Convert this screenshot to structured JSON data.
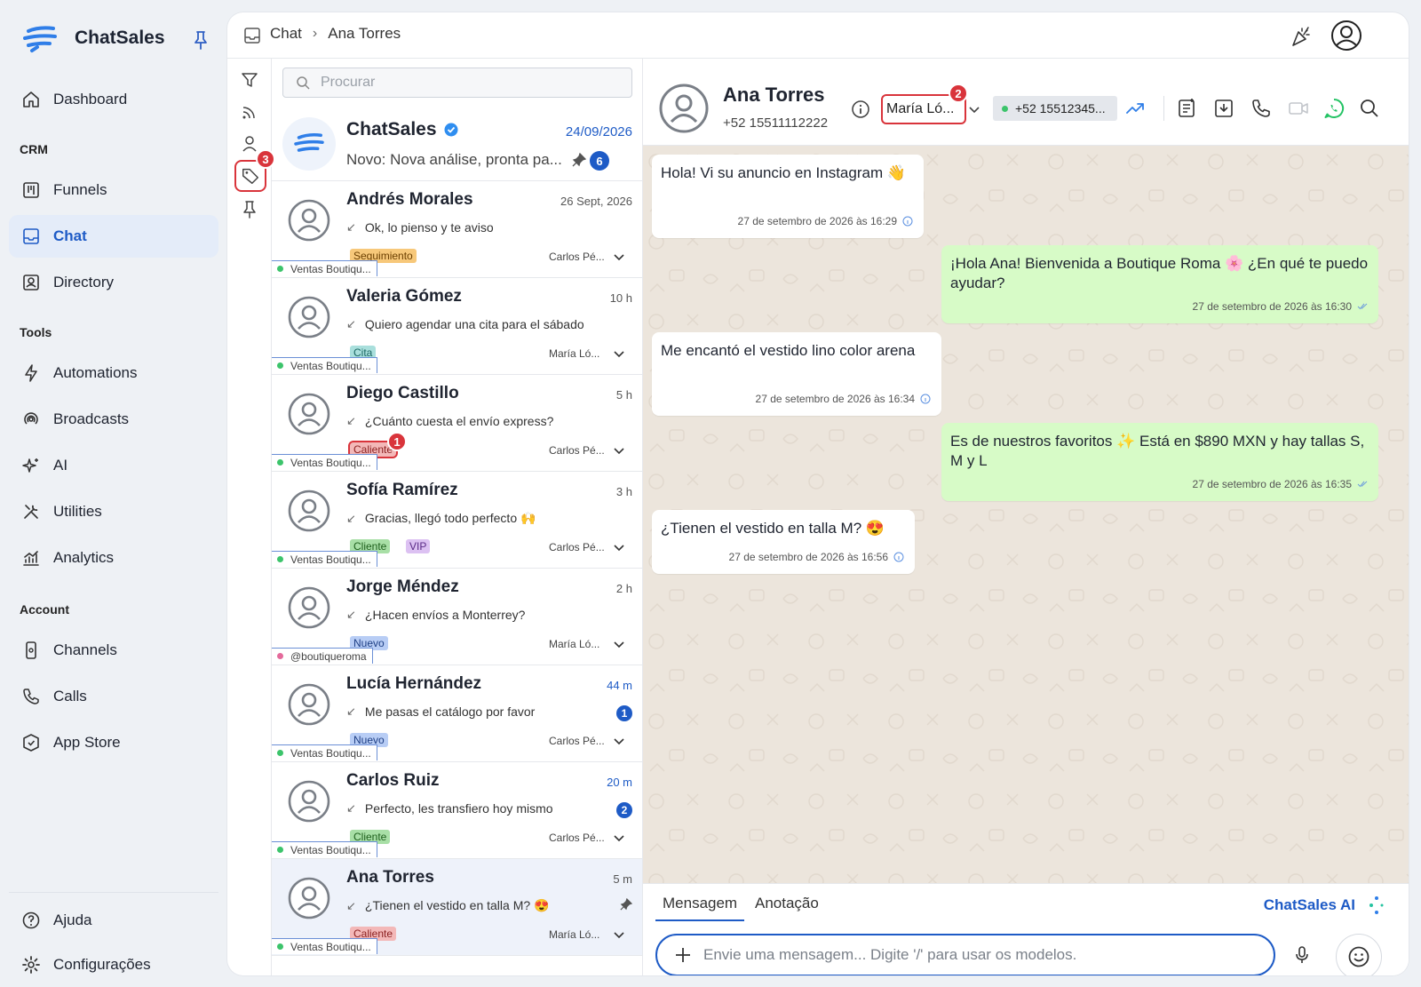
{
  "sidebar": {
    "brand": "ChatSales",
    "items": [
      {
        "label": "Dashboard"
      },
      {
        "section": "CRM"
      },
      {
        "label": "Funnels"
      },
      {
        "label": "Chat"
      },
      {
        "label": "Directory"
      },
      {
        "section": "Tools"
      },
      {
        "label": "Automations"
      },
      {
        "label": "Broadcasts"
      },
      {
        "label": "AI"
      },
      {
        "label": "Utilities"
      },
      {
        "label": "Analytics"
      },
      {
        "section": "Account"
      },
      {
        "label": "Channels"
      },
      {
        "label": "Calls"
      },
      {
        "label": "App Store"
      }
    ],
    "bottom": [
      {
        "label": "Ajuda"
      },
      {
        "label": "Configurações"
      }
    ]
  },
  "breadcrumb": {
    "root": "Chat",
    "current": "Ana Torres"
  },
  "filters": {
    "tag_badge": "3"
  },
  "search": {
    "placeholder": "Procurar"
  },
  "pinned": {
    "name": "ChatSales",
    "date": "24/09/2026",
    "preview": "Novo: Nova análise, pronta pa...",
    "count": "6"
  },
  "conversations": [
    {
      "name": "Andrés Morales",
      "time": "26 Sept, 2026",
      "preview": "Ok, lo pienso y te aviso",
      "tags": [
        "Seguimiento"
      ],
      "agent": "Carlos Pé...",
      "channel": "Ventas Boutiqu..."
    },
    {
      "name": "Valeria Gómez",
      "time": "10 h",
      "preview": "Quiero agendar una cita para el sábado",
      "tags": [
        "Cita"
      ],
      "agent": "María Ló...",
      "channel": "Ventas Boutiqu..."
    },
    {
      "name": "Diego Castillo",
      "time": "5 h",
      "preview": "¿Cuánto cuesta el envío express?",
      "tags": [
        "Caliente"
      ],
      "tag_badge": "1",
      "agent": "Carlos Pé...",
      "channel": "Ventas Boutiqu..."
    },
    {
      "name": "Sofía Ramírez",
      "time": "3 h",
      "preview": "Gracias, llegó todo perfecto 🙌",
      "tags": [
        "Cliente",
        "VIP"
      ],
      "agent": "Carlos Pé...",
      "channel": "Ventas Boutiqu..."
    },
    {
      "name": "Jorge Méndez",
      "time": "2 h",
      "preview": "¿Hacen envíos a Monterrey?",
      "tags": [
        "Nuevo"
      ],
      "agent": "María Ló...",
      "channel": "@boutiqueroma"
    },
    {
      "name": "Lucía Hernández",
      "time": "44 m",
      "preview": "Me pasas el catálogo por favor",
      "tags": [
        "Nuevo"
      ],
      "unread": "1",
      "agent": "Carlos Pé...",
      "channel": "Ventas Boutiqu..."
    },
    {
      "name": "Carlos Ruiz",
      "time": "20 m",
      "preview": "Perfecto, les transfiero hoy mismo",
      "tags": [
        "Cliente"
      ],
      "unread": "2",
      "agent": "Carlos Pé...",
      "channel": "Ventas Boutiqu..."
    },
    {
      "name": "Ana Torres",
      "time": "5 m",
      "preview": "¿Tienen el vestido en talla M? 😍",
      "tags": [
        "Caliente"
      ],
      "agent": "María Ló...",
      "channel": "Ventas Boutiqu..."
    }
  ],
  "chat": {
    "name": "Ana Torres",
    "phone": "+52 15511112222",
    "agent": "María Ló...",
    "agent_badge": "2",
    "channel_phone": "+52 15512345...",
    "messages": [
      {
        "dir": "in",
        "text": "Hola! Vi su anuncio en Instagram 👋",
        "time": "27 de setembro de 2026 às 16:29"
      },
      {
        "dir": "out",
        "text": "¡Hola Ana! Bienvenida a Boutique Roma 🌸 ¿En qué te puedo ayudar?",
        "time": "27 de setembro de 2026 às 16:30"
      },
      {
        "dir": "in",
        "text": "Me encantó el vestido lino color arena",
        "time": "27 de setembro de 2026 às 16:34"
      },
      {
        "dir": "out",
        "text": "Es de nuestros favoritos ✨  Está en $890 MXN y hay tallas S, M y L",
        "time": "27 de setembro de 2026 às 16:35"
      },
      {
        "dir": "in",
        "text": "¿Tienen el vestido en talla M? 😍",
        "time": "27 de setembro de 2026 às 16:56"
      }
    ]
  },
  "composer": {
    "tab_message": "Mensagem",
    "tab_note": "Anotação",
    "ai_label": "ChatSales AI",
    "placeholder": "Envie uma mensagem... Digite '/' para usar os modelos."
  },
  "colors": {
    "accent": "#1e5bc6",
    "highlight": "#d9343b",
    "outgoing": "#d7fbc7",
    "chat_bg": "#ece5dc"
  }
}
